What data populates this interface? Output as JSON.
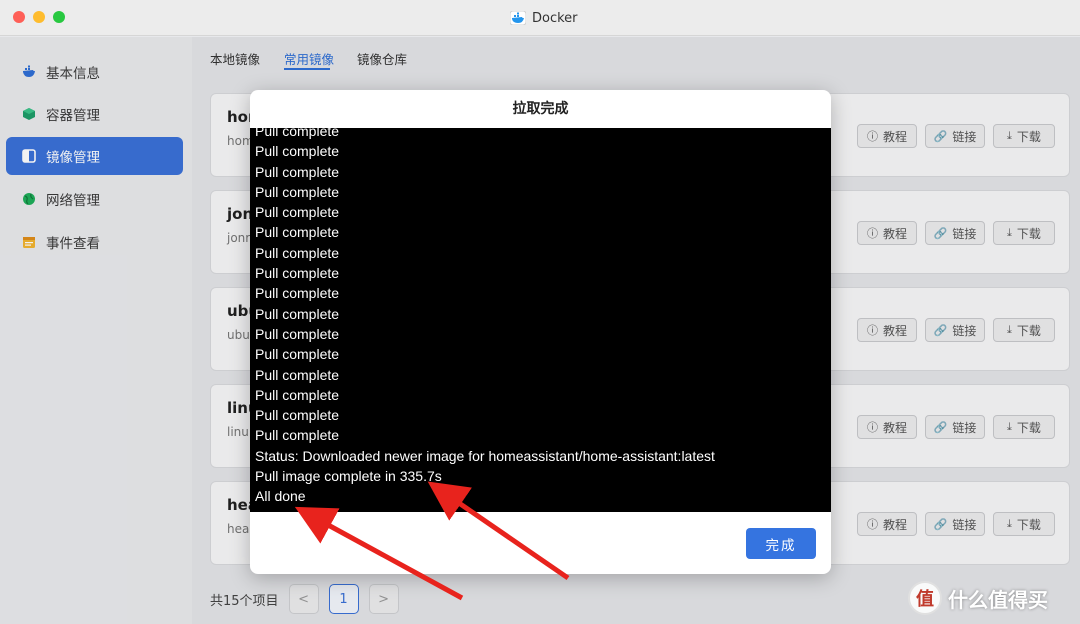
{
  "window": {
    "title": "Docker"
  },
  "sidebar": {
    "items": [
      {
        "label": "基本信息",
        "icon": "whale-icon"
      },
      {
        "label": "容器管理",
        "icon": "cube-icon"
      },
      {
        "label": "镜像管理",
        "icon": "image-icon",
        "active": true
      },
      {
        "label": "网络管理",
        "icon": "globe-icon"
      },
      {
        "label": "事件查看",
        "icon": "calendar-icon"
      }
    ]
  },
  "tabs": [
    {
      "label": "本地镜像"
    },
    {
      "label": "常用镜像",
      "active": true
    },
    {
      "label": "镜像仓库"
    }
  ],
  "cards": [
    {
      "name": "hor",
      "sub": "hom"
    },
    {
      "name": "jon",
      "sub": "jonr"
    },
    {
      "name": "ubu",
      "sub": "ubu"
    },
    {
      "name": "linu",
      "sub": "linu"
    },
    {
      "name": "hea",
      "sub": "hea"
    }
  ],
  "card_buttons": {
    "tutorial": "教程",
    "link": "链接",
    "download": "下载"
  },
  "pager": {
    "total": "共15个项目",
    "prev": "<",
    "current": "1",
    "next": ">"
  },
  "dialog": {
    "title": "拉取完成",
    "lines": [
      "Pull complete",
      "Pull complete",
      "Pull complete",
      "Pull complete",
      "Pull complete",
      "Pull complete",
      "Pull complete",
      "Pull complete",
      "Pull complete",
      "Pull complete",
      "Pull complete",
      "Pull complete",
      "Pull complete",
      "Pull complete",
      "Pull complete",
      "Pull complete",
      "Status: Downloaded newer image for homeassistant/home-assistant:latest",
      "Pull image complete in 335.7s",
      "All done"
    ],
    "done_label": "完成"
  },
  "watermark": {
    "logo": "值",
    "text": "什么值得买"
  },
  "colors": {
    "accent": "#3a71d8",
    "primary_button": "#3574e0",
    "arrow": "#e8231d"
  }
}
